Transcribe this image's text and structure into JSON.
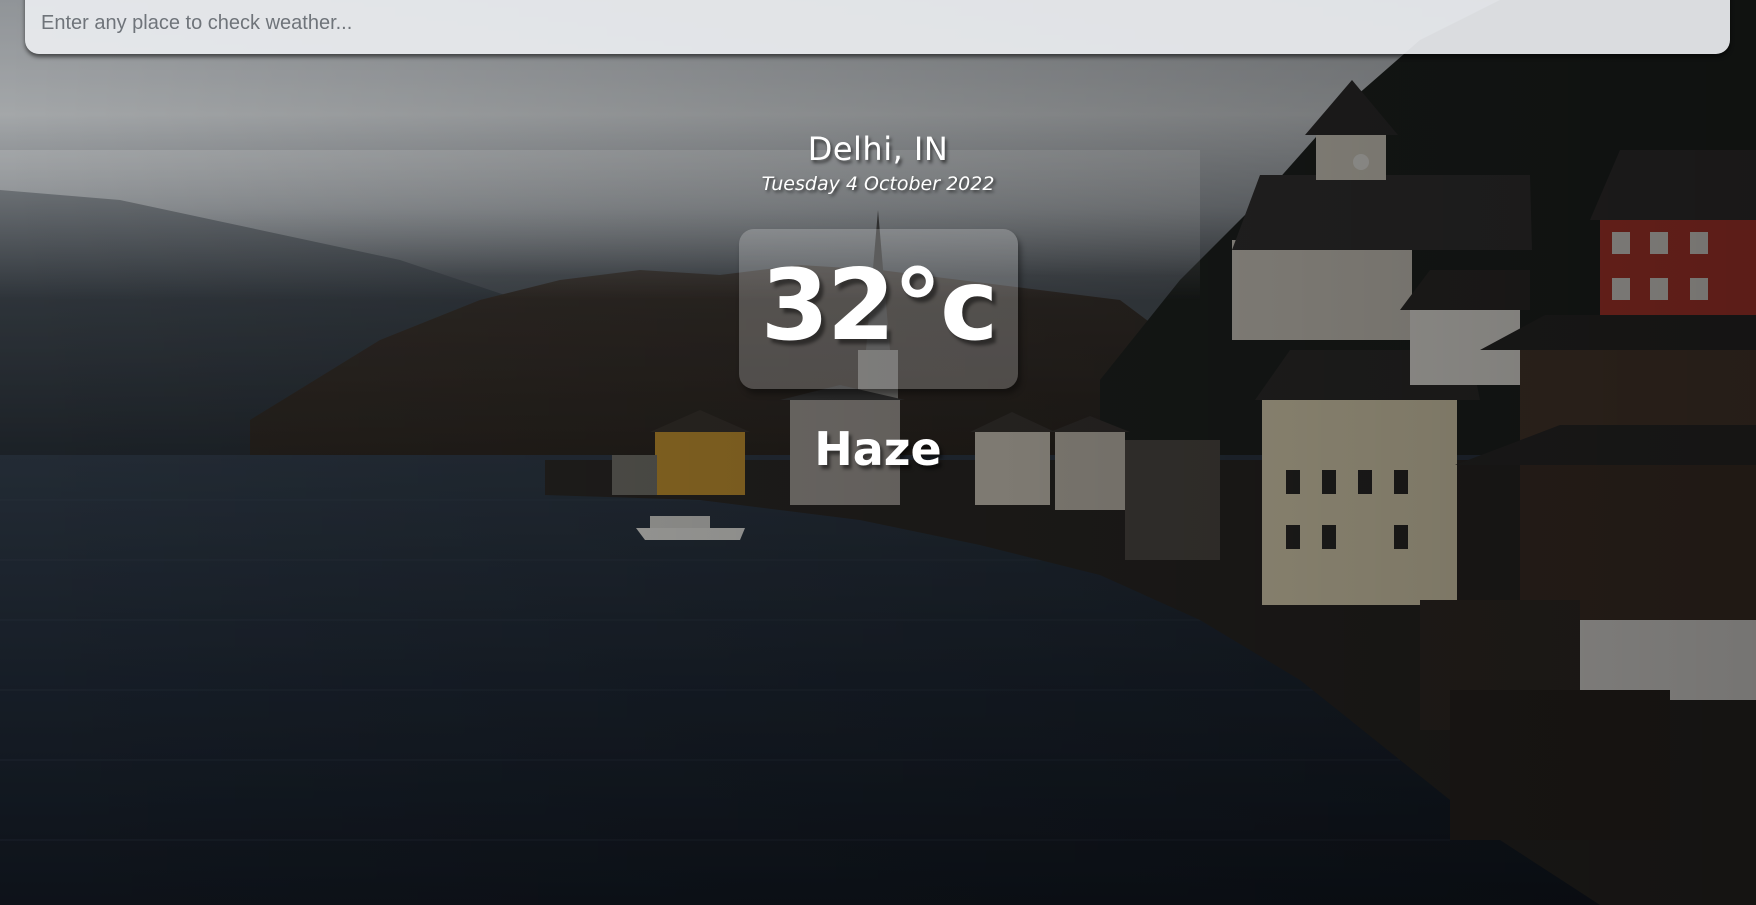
{
  "search": {
    "placeholder": "Enter any place to check weather...",
    "value": ""
  },
  "weather": {
    "location": "Delhi, IN",
    "date": "Tuesday 4 October 2022",
    "temperature": "32°c",
    "condition": "Haze"
  },
  "background": {
    "description_icon": "lakeside-village-background",
    "colors": {
      "sky": "#c7ccd0",
      "mountain": "#2b3138",
      "water": "#1b2430",
      "village": "#3a3633",
      "accent_house": "#b5392f"
    }
  }
}
